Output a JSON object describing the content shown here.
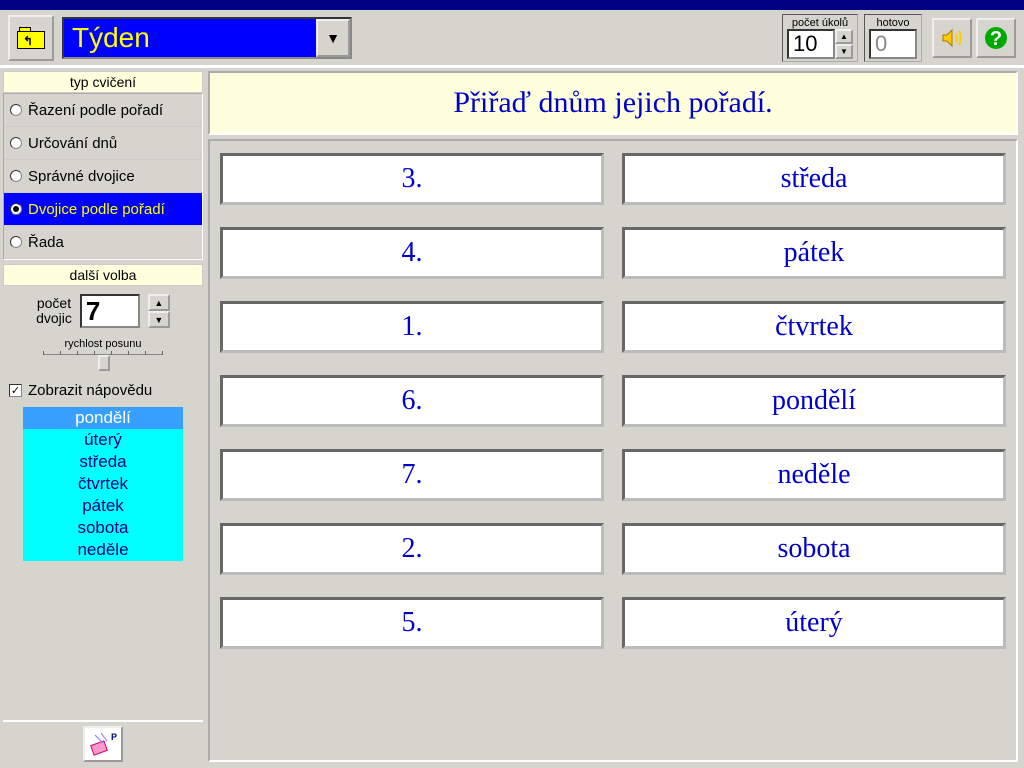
{
  "toolbar": {
    "title": "Týden",
    "tasks_label": "počet úkolů",
    "tasks_value": "10",
    "done_label": "hotovo",
    "done_value": "0"
  },
  "sidebar": {
    "exercise_type_label": "typ cvičení",
    "exercise_types": [
      {
        "label": "Řazení podle pořadí",
        "selected": false
      },
      {
        "label": "Určování dnů",
        "selected": false
      },
      {
        "label": "Správné dvojice",
        "selected": false
      },
      {
        "label": "Dvojice podle pořadí",
        "selected": true
      },
      {
        "label": "Řada",
        "selected": false
      }
    ],
    "other_option_label": "další volba",
    "pairs_label_line1": "počet",
    "pairs_label_line2": "dvojic",
    "pairs_value": "7",
    "speed_label": "rychlost posunu",
    "show_hint_label": "Zobrazit nápovědu",
    "show_hint_checked": true,
    "hints": [
      {
        "label": "pondělí",
        "highlight": true
      },
      {
        "label": "úterý",
        "highlight": false
      },
      {
        "label": "středa",
        "highlight": false
      },
      {
        "label": "čtvrtek",
        "highlight": false
      },
      {
        "label": "pátek",
        "highlight": false
      },
      {
        "label": "sobota",
        "highlight": false
      },
      {
        "label": "neděle",
        "highlight": false
      }
    ]
  },
  "instruction": "Přiřaď dnům jejich pořadí.",
  "pairs": [
    {
      "left": "3.",
      "right": "středa"
    },
    {
      "left": "4.",
      "right": "pátek"
    },
    {
      "left": "1.",
      "right": "čtvrtek"
    },
    {
      "left": "6.",
      "right": "pondělí"
    },
    {
      "left": "7.",
      "right": "neděle"
    },
    {
      "left": "2.",
      "right": "sobota"
    },
    {
      "left": "5.",
      "right": "úterý"
    }
  ]
}
